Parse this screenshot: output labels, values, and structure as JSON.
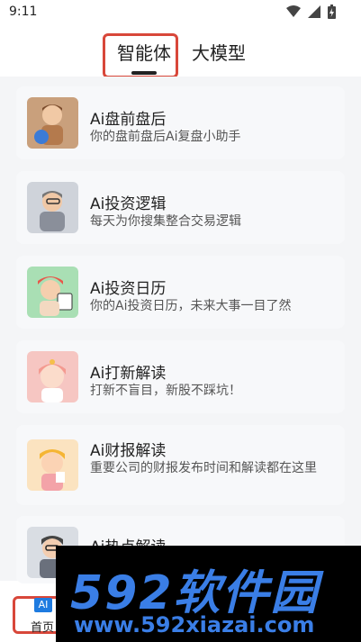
{
  "status_bar": {
    "time": "9:11"
  },
  "tabs": [
    {
      "label": "智能体",
      "active": true
    },
    {
      "label": "大模型",
      "active": false
    }
  ],
  "cards": [
    {
      "title": "Ai盘前盘后",
      "desc": "你的盘前盘后Ai复盘小助手"
    },
    {
      "title": "Ai投资逻辑",
      "desc": "每天为你搜集整合交易逻辑"
    },
    {
      "title": "Ai投资日历",
      "desc": "你的Ai投资日历，未来大事一目了然"
    },
    {
      "title": "Ai打新解读",
      "desc": "打新不盲目，新股不踩坑！"
    },
    {
      "title": "Ai财报解读",
      "desc": "重要公司的财报发布时间和解读都在这里"
    },
    {
      "title": "Ai热点解读",
      "desc": ""
    }
  ],
  "watermark": {
    "logo": "592软件园",
    "url": "www.592xiazai.com"
  },
  "bottom_nav": {
    "badge": "AI",
    "home_label": "首页"
  },
  "colors": {
    "highlight": "#d8473a",
    "accent": "#1e7be0"
  }
}
